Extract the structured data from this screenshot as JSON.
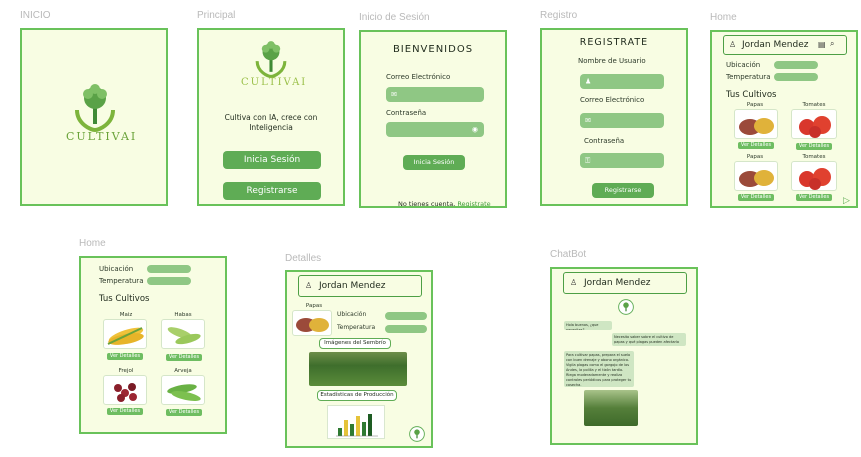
{
  "frames": {
    "inicio": {
      "label": "INICIO",
      "logo_text": "CULTIVAI"
    },
    "principal": {
      "label": "Principal",
      "logo_text": "CULTIVAI",
      "tagline": "Cultiva con IA, crece con Inteligencia",
      "login_button": "Inicia Sesión",
      "register_button": "Registrarse"
    },
    "login": {
      "label": "Inicio de Sesión",
      "title": "BIENVENIDOS",
      "email_label": "Correo Electrónico",
      "password_label": "Contraseña",
      "submit_button": "Inicia Sesión",
      "no_account_text": "No tienes cuenta,",
      "register_link": "Registrate"
    },
    "registro": {
      "label": "Registro",
      "title": "REGISTRATE",
      "username_label": "Nombre de Usuario",
      "email_label": "Correo Electrónico",
      "password_label": "Contraseña",
      "submit_button": "Registrarse"
    },
    "home1": {
      "label": "Home",
      "user_name": "Jordan Mendez",
      "location_label": "Ubicación",
      "temperature_label": "Temperatura",
      "crops_title": "Tus Cultivos",
      "crops": [
        {
          "name": "Papas",
          "action": "Ver Detalles"
        },
        {
          "name": "Tomates",
          "action": "Ver Detalles"
        },
        {
          "name": "Papas",
          "action": "Ver Detalles"
        },
        {
          "name": "Tomates",
          "action": "Ver Detalles"
        }
      ]
    },
    "home2": {
      "label": "Home",
      "location_label": "Ubicación",
      "temperature_label": "Temperatura",
      "crops_title": "Tus Cultivos",
      "crops": [
        {
          "name": "Maiz",
          "action": "Ver Detalles"
        },
        {
          "name": "Habas",
          "action": "Ver Detalles"
        },
        {
          "name": "Frejol",
          "action": "Ver Detalles"
        },
        {
          "name": "Arveja",
          "action": "Ver Detalles"
        }
      ]
    },
    "detalles": {
      "label": "Detalles",
      "user_name": "Jordan Mendez",
      "crop_name": "Papas",
      "location_label": "Ubicación",
      "temperature_label": "Temperatura",
      "images_button": "Imágenes del Sembrío",
      "stats_button": "Estadísticas de Producción"
    },
    "chatbot": {
      "label": "ChatBot",
      "user_name": "Jordan Mendez",
      "msg_user_1": "Hola buenos, ¿que necesitas?",
      "msg_bot_1": "Necesito saber sobre el cultivo de papas y qué plagas pueden afectarlo",
      "msg_bot_2": "Para cultivar papas, prepara el suelo con buen drenaje y abono orgánico. Vigila plagas como el gorgojo de los Andes, la polilla y el tizón tardío. Riega moderadamente y realiza controles periódicos para proteger tu cosecha."
    }
  },
  "colors": {
    "accent": "#5fac55",
    "frame_border": "#69c25a",
    "frame_bg": "#f8fde3",
    "field": "#8fc784"
  }
}
